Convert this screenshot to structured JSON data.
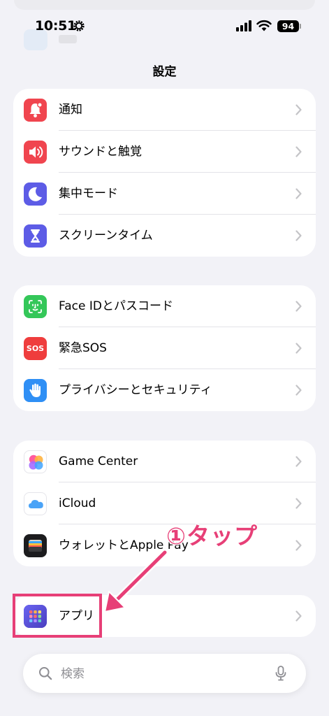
{
  "status_bar": {
    "time": "10:51",
    "battery": "94"
  },
  "title": "設定",
  "groups": [
    {
      "rows": [
        {
          "label": "通知",
          "icon": "bell-icon",
          "color": "#f0454f"
        },
        {
          "label": "サウンドと触覚",
          "icon": "speaker-icon",
          "color": "#f0454f"
        },
        {
          "label": "集中モード",
          "icon": "moon-icon",
          "color": "#5d5ce6"
        },
        {
          "label": "スクリーンタイム",
          "icon": "hourglass-icon",
          "color": "#5d5ce6"
        }
      ]
    },
    {
      "rows": [
        {
          "label": "Face IDとパスコード",
          "icon": "faceid-icon",
          "color": "#34c759"
        },
        {
          "label": "緊急SOS",
          "icon": "sos-icon",
          "color": "#ef3d3d",
          "icon_text": "SOS"
        },
        {
          "label": "プライバシーとセキュリティ",
          "icon": "hand-icon",
          "color": "#2f8ff5"
        }
      ]
    },
    {
      "rows": [
        {
          "label": "Game Center",
          "icon": "game-center-icon",
          "color": "#ffffff"
        },
        {
          "label": "iCloud",
          "icon": "cloud-icon",
          "color": "#ffffff"
        },
        {
          "label": "ウォレットとApple Pay",
          "icon": "wallet-icon",
          "color": "#1c1c1e"
        }
      ]
    },
    {
      "rows": [
        {
          "label": "アプリ",
          "icon": "apps-grid-icon",
          "color": "#5e56d6"
        }
      ]
    }
  ],
  "search": {
    "placeholder": "検索"
  },
  "annotation": {
    "text": "①タップ",
    "color": "#e73f77"
  }
}
